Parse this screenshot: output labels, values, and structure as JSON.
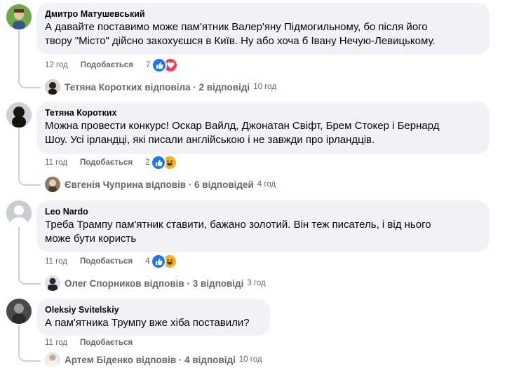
{
  "comments": [
    {
      "author": "Дмитро Матушевський",
      "text_lines": [
        "А давайте поставимо може пам'ятник Валер'яну Підмогильному, бо після його",
        "твору \"Місто\" дійсно закохуєшся в Київ. Ну або хоча б Івану Нечую-Левицькому."
      ],
      "time": "12 год",
      "like_label": "Подобається",
      "reaction_count": "7",
      "reactions": [
        "like-icon",
        "love-icon"
      ],
      "reply_author_line": "Тетяна Коротких відповіла · 2 відповіді",
      "reply_time": "10 год"
    },
    {
      "author": "Тетяна Коротких",
      "text_lines": [
        "Можна провести конкурс! Оскар Вайлд, Джонатан Свіфт, Брем Стокер і Бернард",
        "Шоу. Усі ірландці, які писали англійською і не завжди про ірландців."
      ],
      "time": "11 год",
      "like_label": "Подобається",
      "reaction_count": "2",
      "reactions": [
        "like-icon",
        "haha-icon"
      ],
      "reply_author_line": "Євгенія Чуприна відповів · 6 відповідей",
      "reply_time": "4 год"
    },
    {
      "author": "Leo Nardo",
      "text_lines": [
        "Треба Трампу пам'ятник ставити, бажано золотий. Він теж писатель, і від нього",
        "може бути користь"
      ],
      "time": "11 год",
      "like_label": "Подобається",
      "reaction_count": "4",
      "reactions": [
        "like-icon",
        "haha-icon"
      ],
      "reply_author_line": "Олег Спорников відповів · 3 відповіді",
      "reply_time": "3 год"
    },
    {
      "author": "Oleksiy Svitelskiy",
      "text_lines": [
        "А пам'ятника Трумпу вже хіба поставили?"
      ],
      "time": "11 год",
      "like_label": "Подобається",
      "reaction_count": "",
      "reactions": [],
      "reply_author_line": "Артем Біденко відповів · 4 відповіді",
      "reply_time": "10 год"
    }
  ],
  "colors": {
    "bubble": "#f0f2f5",
    "meta": "#65676b",
    "like_blue": "#1877f2",
    "love_red": "#f33e58",
    "haha_yellow": "#f7b125"
  }
}
